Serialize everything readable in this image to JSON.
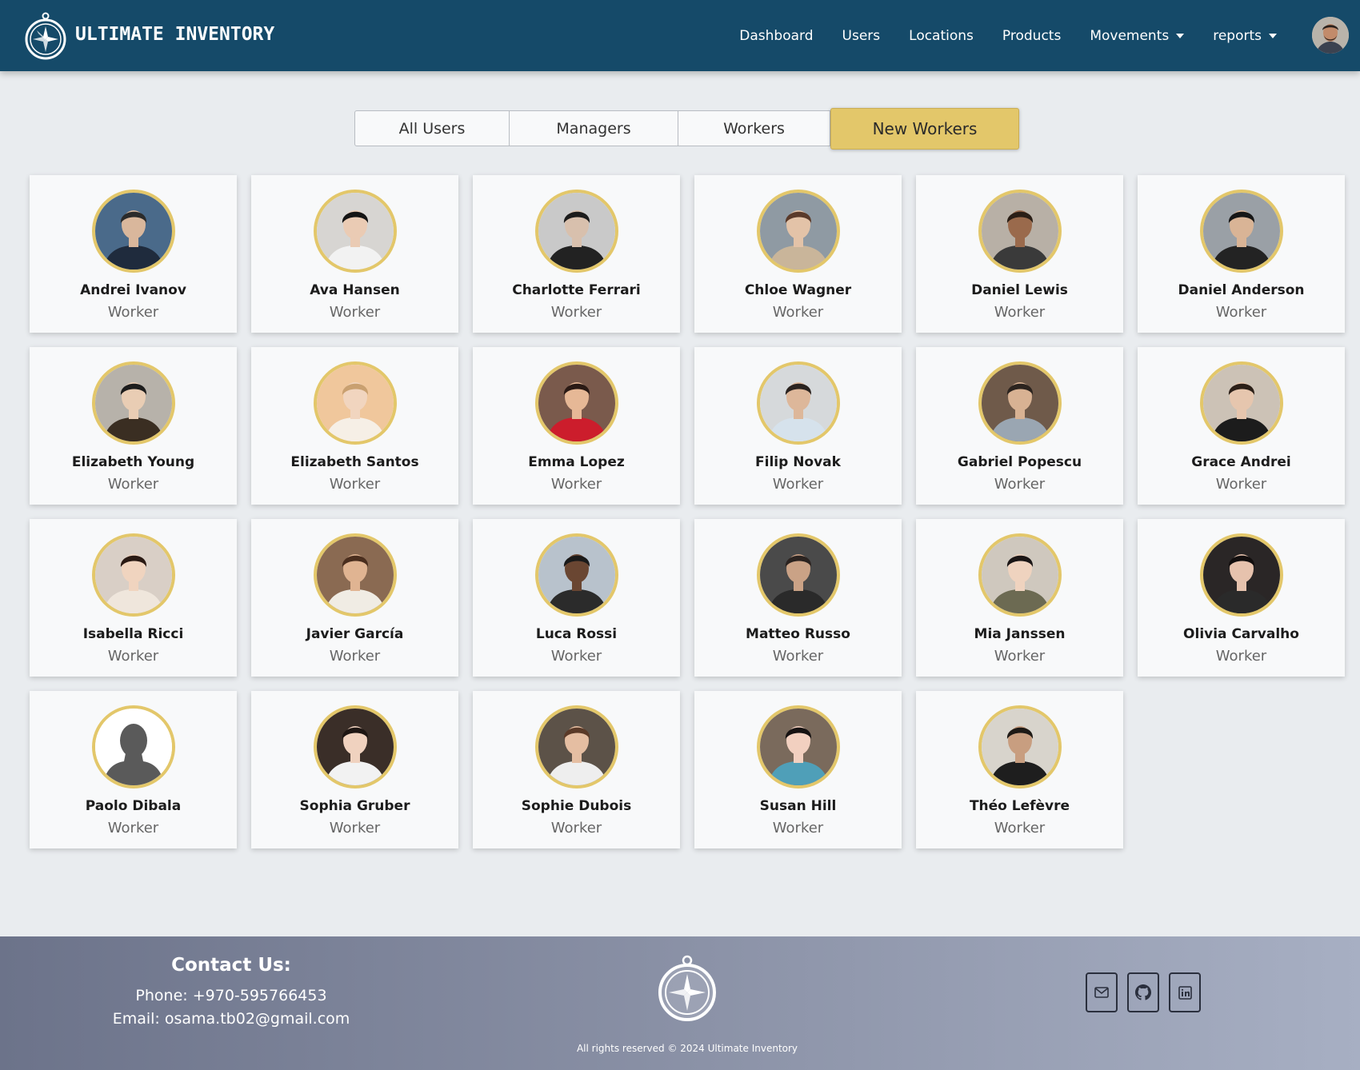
{
  "brand": {
    "name": "ULTIMATE INVENTORY",
    "icon": "compass-icon"
  },
  "nav": {
    "dashboard": "Dashboard",
    "users": "Users",
    "locations": "Locations",
    "products": "Products",
    "movements": "Movements",
    "reports": "reports"
  },
  "tabs": {
    "all_users": "All Users",
    "managers": "Managers",
    "workers": "Workers",
    "new_workers": "New Workers",
    "active": "New Workers"
  },
  "users": [
    {
      "name": "Andrei Ivanov",
      "role": "Worker"
    },
    {
      "name": "Ava Hansen",
      "role": "Worker"
    },
    {
      "name": "Charlotte Ferrari",
      "role": "Worker"
    },
    {
      "name": "Chloe Wagner",
      "role": "Worker"
    },
    {
      "name": "Daniel Lewis",
      "role": "Worker"
    },
    {
      "name": "Daniel Anderson",
      "role": "Worker"
    },
    {
      "name": "Elizabeth Young",
      "role": "Worker"
    },
    {
      "name": "Elizabeth Santos",
      "role": "Worker"
    },
    {
      "name": "Emma Lopez",
      "role": "Worker"
    },
    {
      "name": "Filip Novak",
      "role": "Worker"
    },
    {
      "name": "Gabriel Popescu",
      "role": "Worker"
    },
    {
      "name": "Grace Andrei",
      "role": "Worker"
    },
    {
      "name": "Isabella Ricci",
      "role": "Worker"
    },
    {
      "name": "Javier García",
      "role": "Worker"
    },
    {
      "name": "Luca Rossi",
      "role": "Worker"
    },
    {
      "name": "Matteo Russo",
      "role": "Worker"
    },
    {
      "name": "Mia Janssen",
      "role": "Worker"
    },
    {
      "name": "Olivia Carvalho",
      "role": "Worker"
    },
    {
      "name": "Paolo Dibala",
      "role": "Worker"
    },
    {
      "name": "Sophia Gruber",
      "role": "Worker"
    },
    {
      "name": "Sophie Dubois",
      "role": "Worker"
    },
    {
      "name": "Susan Hill",
      "role": "Worker"
    },
    {
      "name": "Théo Lefèvre",
      "role": "Worker"
    }
  ],
  "footer": {
    "contact_title": "Contact Us:",
    "phone": "Phone: +970-595766453",
    "email": "Email: osama.tb02@gmail.com",
    "copyright": "All rights reserved © 2024 Ultimate Inventory",
    "social": [
      "mail-icon",
      "github-icon",
      "linkedin-icon"
    ]
  },
  "colors": {
    "navbar": "#154a69",
    "accent": "#e3c76a",
    "page_bg": "#e9ecef"
  }
}
